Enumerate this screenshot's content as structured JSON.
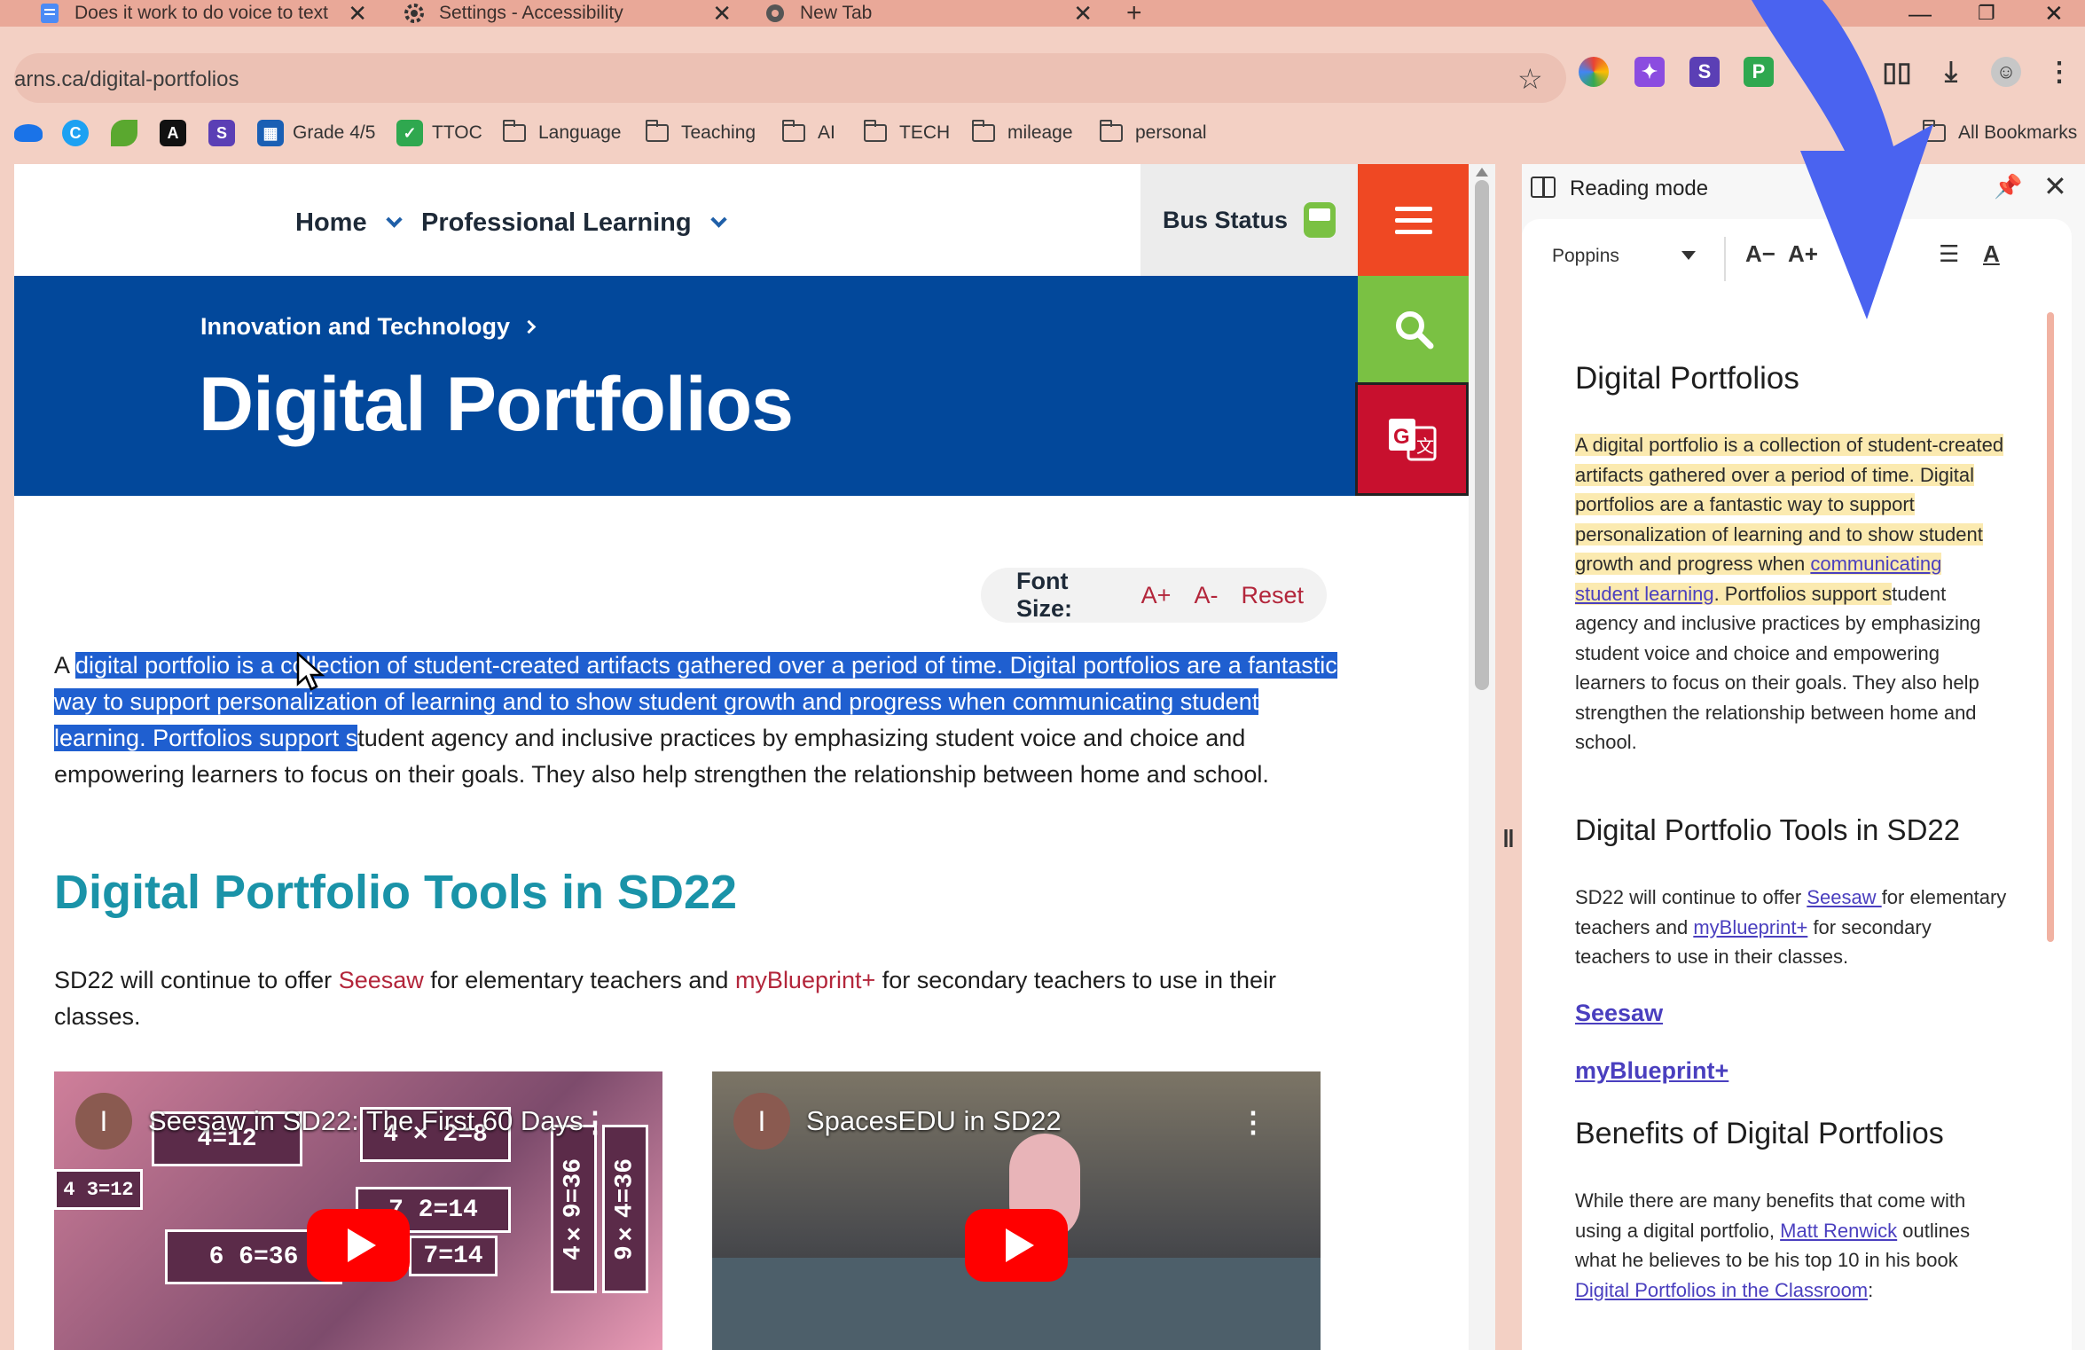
{
  "browser": {
    "tabs": [
      {
        "title": "Does it work to do voice to text",
        "icon": "doc-icon"
      },
      {
        "title": "Settings - Accessibility",
        "icon": "gear-icon"
      },
      {
        "title": "New Tab",
        "icon": "chrome-icon"
      }
    ],
    "new_tab_label": "+",
    "url": "arns.ca/digital-portfolios",
    "bookmarks": [
      {
        "label": "Grade 4/5"
      },
      {
        "label": "TTOC"
      },
      {
        "label": "Language"
      },
      {
        "label": "Teaching"
      },
      {
        "label": "AI"
      },
      {
        "label": "TECH"
      },
      {
        "label": "mileage"
      },
      {
        "label": "personal"
      }
    ],
    "all_bookmarks": "All Bookmarks"
  },
  "site": {
    "nav": [
      {
        "label": "Home"
      },
      {
        "label": "Professional Learning"
      }
    ],
    "bus_status": "Bus Status",
    "breadcrumb": "Innovation and Technology",
    "title": "Digital Portfolios",
    "font_size": {
      "label": "Font Size:",
      "increase": "A+",
      "decrease": "A-",
      "reset": "Reset"
    },
    "intro": {
      "lead": "A ",
      "selected": "digital portfolio is a collection of student-created artifacts gathered over a period of time. Digital portfolios are a fantastic way to support personalization of learning and to show student growth and progress when communicating student learning.  Portfolios support s",
      "rest": "tudent agency and inclusive practices by emphasizing student voice and choice and empowering learners to focus on their goals. They also help strengthen the relationship between home and school."
    },
    "tools_heading": "Digital Portfolio Tools in SD22",
    "tools_text": {
      "a": "SD22 will continue to offer ",
      "seesaw": "Seesaw",
      "b": " for elementary teachers and ",
      "myblueprint": "myBlueprint+",
      "c": " for secondary teachers to use in their classes."
    },
    "videos": [
      {
        "title": "Seesaw in SD22: The First 60 Days",
        "avatar": "I",
        "tiles": [
          "4=12",
          "4 × 2=8",
          "4  3=12",
          "7  2=14",
          "6  6=36",
          "7=14",
          "4×9=36",
          "9×4=36"
        ]
      },
      {
        "title": "SpacesEDU in SD22",
        "avatar": "I"
      }
    ]
  },
  "reading_mode": {
    "title": "Reading mode",
    "font": "Poppins",
    "decrease": "A−",
    "increase": "A+",
    "h1": "Digital Portfolios",
    "p1_highlight_a": "A digital portfolio is a collection of student-created artifacts gathered over a period of time. Digital portfolios are a fantastic way to support personalization of learning and to show student growth and progress when ",
    "p1_link": "communicating student learning",
    "p1_highlight_b": ". Portfolios support s",
    "p1_rest": "tudent agency and inclusive practices by emphasizing student voice and choice and empowering learners to focus on their goals. They also help strengthen the relationship between home and school.",
    "h2": "Digital Portfolio Tools in SD22",
    "p2_a": "SD22 will continue to offer ",
    "p2_seesaw": "Seesaw ",
    "p2_b": "for elementary teachers and ",
    "p2_myblueprint": "myBlueprint+",
    "p2_c": " for secondary teachers to use in their classes.",
    "link_seesaw": "Seesaw",
    "link_myblueprint": "myBlueprint+",
    "h3": "Benefits of Digital Portfolios",
    "p3_a": "While there are many benefits that come with using a digital portfolio, ",
    "p3_link1": "Matt Renwick",
    "p3_b": " outlines what he believes to be his top 10 in his book ",
    "p3_link2": "Digital Portfolios in the Classroom",
    "p3_c": ":"
  },
  "colors": {
    "hero_blue": "#02489b",
    "menu_orange": "#ef4823",
    "search_green": "#7ac143",
    "translate_red": "#c8102e",
    "heading_teal": "#1a93a8",
    "link_red": "#b3263b",
    "selection_blue": "#1f5fd0",
    "annotation_arrow": "#4a63f0"
  }
}
